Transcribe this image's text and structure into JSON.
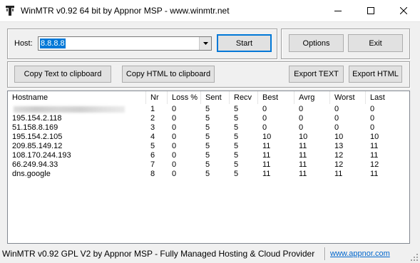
{
  "window": {
    "title": "WinMTR v0.92 64 bit by Appnor MSP - www.winmtr.net"
  },
  "host": {
    "label": "Host:",
    "value": "8.8.8.8"
  },
  "buttons": {
    "start": "Start",
    "options": "Options",
    "exit": "Exit",
    "copy_text": "Copy Text to clipboard",
    "copy_html": "Copy HTML to clipboard",
    "export_text": "Export TEXT",
    "export_html": "Export HTML"
  },
  "table": {
    "columns": [
      "Hostname",
      "Nr",
      "Loss %",
      "Sent",
      "Recv",
      "Best",
      "Avrg",
      "Worst",
      "Last"
    ],
    "rows": [
      {
        "hostname": "",
        "nr": "1",
        "loss": "0",
        "sent": "5",
        "recv": "5",
        "best": "0",
        "avrg": "0",
        "worst": "0",
        "last": "0"
      },
      {
        "hostname": "195.154.2.118",
        "nr": "2",
        "loss": "0",
        "sent": "5",
        "recv": "5",
        "best": "0",
        "avrg": "0",
        "worst": "0",
        "last": "0"
      },
      {
        "hostname": "51.158.8.169",
        "nr": "3",
        "loss": "0",
        "sent": "5",
        "recv": "5",
        "best": "0",
        "avrg": "0",
        "worst": "0",
        "last": "0"
      },
      {
        "hostname": "195.154.2.105",
        "nr": "4",
        "loss": "0",
        "sent": "5",
        "recv": "5",
        "best": "10",
        "avrg": "10",
        "worst": "10",
        "last": "10"
      },
      {
        "hostname": "209.85.149.12",
        "nr": "5",
        "loss": "0",
        "sent": "5",
        "recv": "5",
        "best": "11",
        "avrg": "11",
        "worst": "13",
        "last": "11"
      },
      {
        "hostname": "108.170.244.193",
        "nr": "6",
        "loss": "0",
        "sent": "5",
        "recv": "5",
        "best": "11",
        "avrg": "11",
        "worst": "12",
        "last": "11"
      },
      {
        "hostname": "66.249.94.33",
        "nr": "7",
        "loss": "0",
        "sent": "5",
        "recv": "5",
        "best": "11",
        "avrg": "11",
        "worst": "12",
        "last": "12"
      },
      {
        "hostname": "dns.google",
        "nr": "8",
        "loss": "0",
        "sent": "5",
        "recv": "5",
        "best": "11",
        "avrg": "11",
        "worst": "11",
        "last": "11"
      }
    ]
  },
  "statusbar": {
    "text": "WinMTR v0.92 GPL V2 by Appnor MSP - Fully Managed Hosting & Cloud Provider",
    "link": "www.appnor.com"
  },
  "icons": {
    "app": "winmtr-app-icon",
    "minimize": "minimize-icon",
    "maximize": "maximize-icon",
    "close": "close-icon",
    "dropdown": "chevron-down-icon",
    "grip": "resize-grip-icon"
  },
  "colors": {
    "selection": "#0078d7",
    "link": "#0066cc",
    "window_bg": "#f0f0f0"
  }
}
